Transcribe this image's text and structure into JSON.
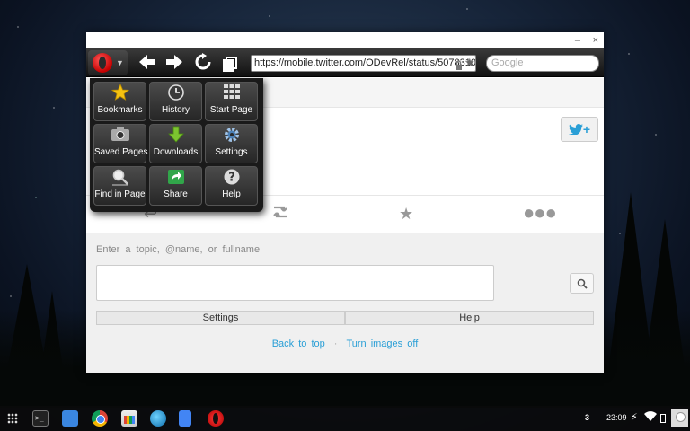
{
  "browser": {
    "url": "https://mobile.twitter.com/ODevRel/status/5078310",
    "search_placeholder": "Google"
  },
  "window": {
    "minimize_glyph": "–",
    "close_glyph": "×"
  },
  "opera_menu": {
    "items": [
      {
        "label": "Bookmarks",
        "icon": "star-icon"
      },
      {
        "label": "History",
        "icon": "clock-icon"
      },
      {
        "label": "Start Page",
        "icon": "grid-icon"
      },
      {
        "label": "Saved Pages",
        "icon": "camera-icon"
      },
      {
        "label": "Downloads",
        "icon": "download-arrow-icon"
      },
      {
        "label": "Settings",
        "icon": "gear-icon"
      },
      {
        "label": "Find in Page",
        "icon": "magnifier-icon"
      },
      {
        "label": "Share",
        "icon": "share-icon"
      },
      {
        "label": "Help",
        "icon": "question-icon"
      }
    ]
  },
  "page": {
    "follow_label": "+",
    "search_hint": "Enter a topic, @name, or fullname",
    "settings_label": "Settings",
    "help_label": "Help",
    "back_to_top": "Back to top",
    "separator": "·",
    "turn_images_off": "Turn images off"
  },
  "taskbar": {
    "notification_count": "3",
    "time": "23:09"
  },
  "colors": {
    "twitter_blue": "#2a9fd6",
    "opera_red": "#cc0f16",
    "toolbar_dark": "#1b1b1b"
  }
}
